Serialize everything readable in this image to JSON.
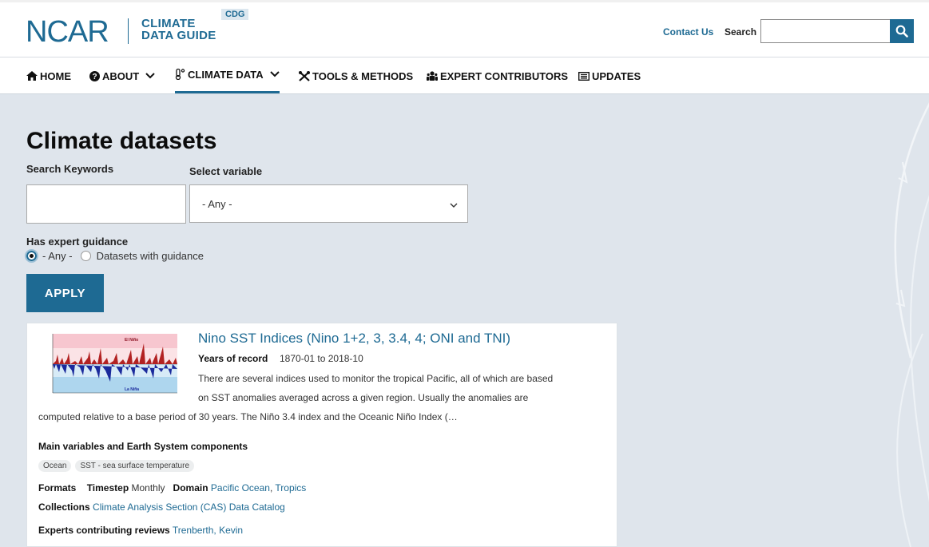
{
  "header": {
    "logo_ncar": "NCAR",
    "logo_line1": "CLIMATE",
    "logo_line2": "DATA GUIDE",
    "logo_badge": "CDG",
    "contact": "Contact Us",
    "search_label": "Search",
    "search_placeholder": ""
  },
  "nav": {
    "home": "HOME",
    "about": "ABOUT",
    "climate_data": "CLIMATE DATA",
    "tools": "TOOLS & METHODS",
    "experts": "EXPERT CONTRIBUTORS",
    "updates": "UPDATES"
  },
  "main": {
    "title": "Climate datasets",
    "keywords_label": "Search Keywords",
    "keywords_value": "",
    "variable_label": "Select variable",
    "variable_selected": "- Any -",
    "guidance_label": "Has expert guidance",
    "radio_any": "- Any -",
    "radio_with": "Datasets with guidance",
    "apply": "APPLY"
  },
  "result": {
    "title": "Nino SST Indices (Nino 1+2, 3, 3.4, 4; ONI and TNI)",
    "years_label": "Years of record",
    "years_value": "1870-01 to 2018-10",
    "desc_line1": "There are several indices used to monitor the tropical Pacific, all of which are based",
    "desc_line2": "on SST anomalies averaged across a given region.  Usually the anomalies are",
    "desc_line3": "computed relative to a base period of 30 years.  The Niño 3.4 index and the Oceanic Niño Index (…",
    "main_vars_label": "Main variables and Earth System components",
    "tags": [
      "Ocean",
      "SST - sea surface temperature"
    ],
    "formats_label": "Formats",
    "timestep_label": "Timestep",
    "timestep_value": "Monthly",
    "domain_label": "Domain",
    "domain_values": [
      "Pacific Ocean",
      "Tropics"
    ],
    "collections_label": "Collections",
    "collections_value": "Climate Analysis Section (CAS) Data Catalog",
    "experts_label": "Experts contributing reviews",
    "experts_value": "Trenberth, Kevin",
    "thumb_labels": [
      "El Niño",
      "La Niña"
    ]
  },
  "colors": {
    "brand": "#1e6a93",
    "background": "#dfe5ec",
    "warm": "#b22222",
    "cool": "#1a2a9c"
  }
}
